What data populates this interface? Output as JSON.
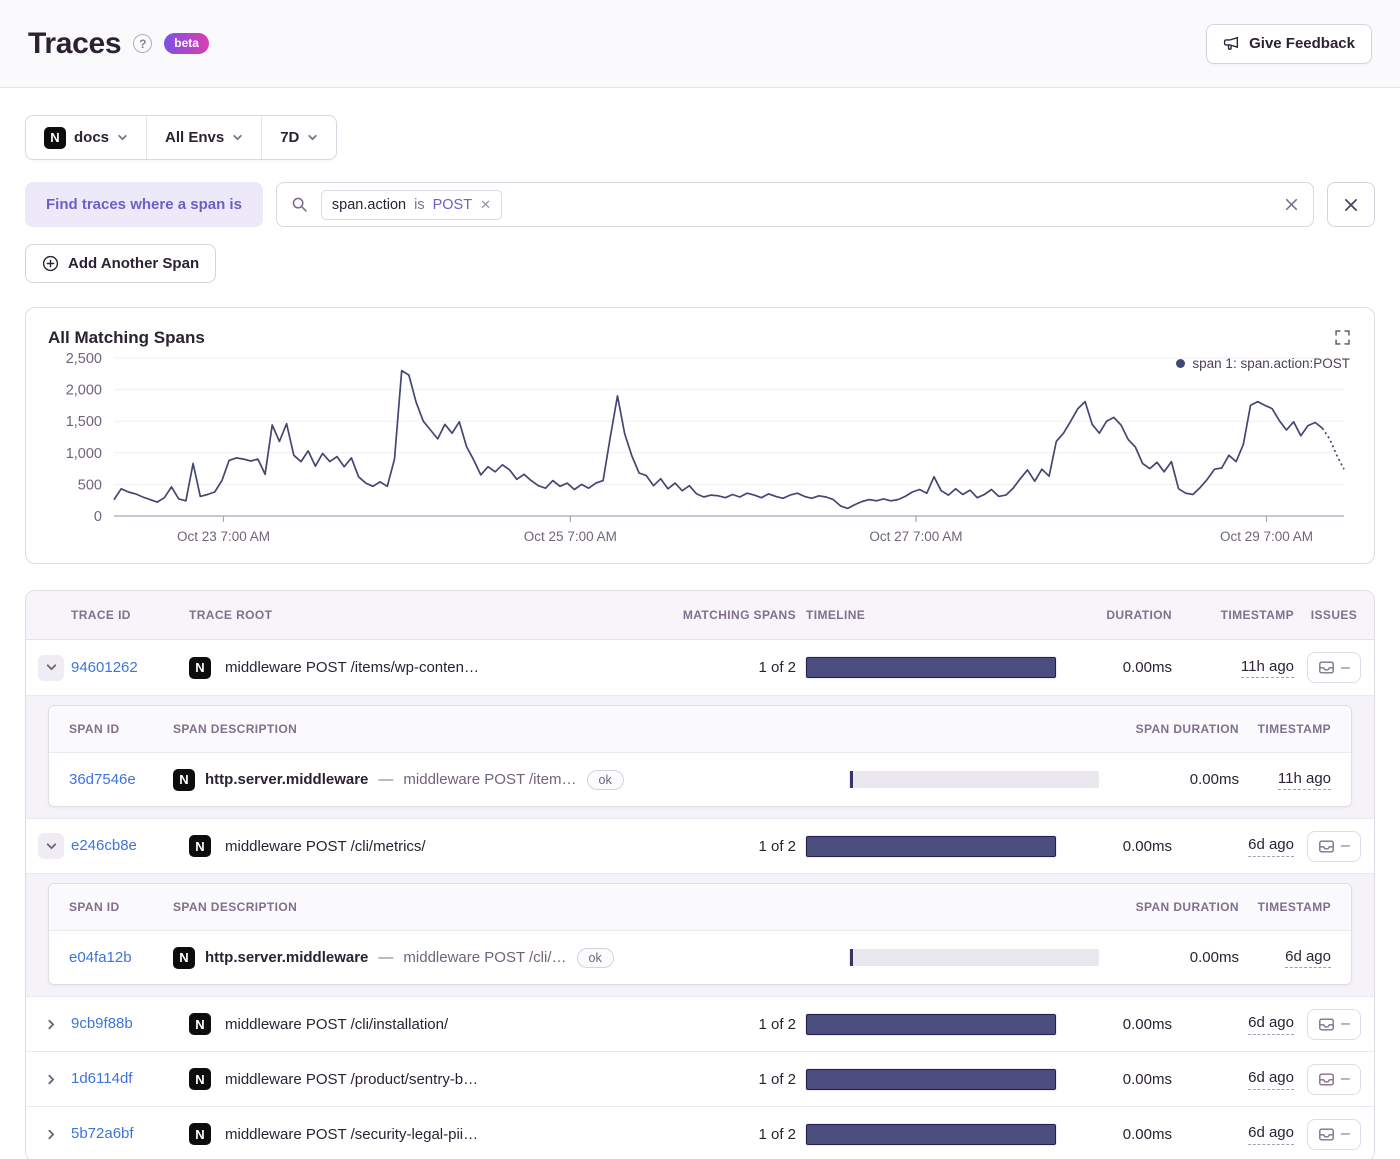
{
  "header": {
    "title": "Traces",
    "beta": "beta",
    "feedback": "Give Feedback"
  },
  "filters": {
    "project": "docs",
    "environment": "All Envs",
    "period": "7D"
  },
  "query": {
    "label": "Find traces where a span is",
    "chip": {
      "key": "span.action",
      "op": "is",
      "value": "POST"
    },
    "add_span": "Add Another Span"
  },
  "chart": {
    "title": "All Matching Spans",
    "legend": "span 1: span.action:POST"
  },
  "chart_data": {
    "type": "line",
    "title": "All Matching Spans",
    "legend_position": "top-right",
    "grid": "horizontal",
    "line_color": "#444674",
    "x_axis": {
      "tick_labels": [
        "Oct 23 7:00 AM",
        "Oct 25 7:00 AM",
        "Oct 27 7:00 AM",
        "Oct 29 7:00 AM"
      ],
      "tick_fractions": [
        0.089,
        0.371,
        0.652,
        0.937
      ],
      "range": "last 7 days, Oct 22 - Oct 29"
    },
    "y_axis": {
      "tick_labels": [
        "0",
        "500",
        "1,000",
        "1,500",
        "2,000",
        "2,500"
      ],
      "tick_values": [
        0,
        500,
        1000,
        1500,
        2000,
        2500
      ],
      "ylim": [
        0,
        2500
      ]
    },
    "dashed_tail_points": 3,
    "series": [
      {
        "name": "span 1: span.action:POST",
        "values": [
          260,
          430,
          380,
          350,
          300,
          260,
          220,
          290,
          460,
          270,
          240,
          830,
          310,
          340,
          380,
          560,
          880,
          920,
          900,
          870,
          900,
          660,
          1440,
          1180,
          1460,
          960,
          860,
          1030,
          790,
          990,
          860,
          940,
          780,
          920,
          620,
          520,
          470,
          540,
          470,
          900,
          2300,
          2230,
          1800,
          1500,
          1360,
          1220,
          1450,
          1310,
          1490,
          1100,
          890,
          650,
          780,
          700,
          810,
          730,
          580,
          660,
          560,
          480,
          440,
          560,
          470,
          520,
          420,
          500,
          440,
          520,
          560,
          1250,
          1900,
          1300,
          950,
          680,
          640,
          480,
          590,
          430,
          520,
          400,
          480,
          350,
          300,
          330,
          320,
          290,
          340,
          300,
          360,
          330,
          290,
          350,
          310,
          280,
          330,
          360,
          310,
          280,
          320,
          300,
          260,
          160,
          120,
          180,
          230,
          260,
          240,
          270,
          240,
          260,
          310,
          380,
          420,
          360,
          620,
          400,
          330,
          430,
          340,
          410,
          290,
          340,
          420,
          310,
          330,
          440,
          590,
          730,
          550,
          740,
          630,
          1180,
          1310,
          1500,
          1700,
          1810,
          1450,
          1310,
          1500,
          1560,
          1440,
          1210,
          1090,
          830,
          750,
          850,
          700,
          860,
          430,
          360,
          340,
          450,
          580,
          740,
          760,
          960,
          860,
          1130,
          1750,
          1810,
          1750,
          1700,
          1510,
          1360,
          1490,
          1270,
          1430,
          1480,
          1390,
          1220,
          960,
          740
        ]
      }
    ]
  },
  "table": {
    "columns": [
      "Trace ID",
      "Trace Root",
      "Matching Spans",
      "Timeline",
      "Duration",
      "Timestamp",
      "Issues"
    ],
    "span_columns": [
      "Span ID",
      "Span Description",
      "Span Duration",
      "Timestamp"
    ],
    "rows": [
      {
        "trace_id": "94601262",
        "root": "middleware POST /items/wp-conten…",
        "matching_spans": "1 of 2",
        "duration": "0.00ms",
        "timestamp": "11h ago",
        "issues": "–",
        "expanded": true,
        "spans": [
          {
            "span_id": "36d7546e",
            "op": "http.server.middleware",
            "description": "middleware POST /item…",
            "status": "ok",
            "duration": "0.00ms",
            "timestamp": "11h ago"
          }
        ]
      },
      {
        "trace_id": "e246cb8e",
        "root": "middleware POST /cli/metrics/",
        "matching_spans": "1 of 2",
        "duration": "0.00ms",
        "timestamp": "6d ago",
        "issues": "–",
        "expanded": true,
        "spans": [
          {
            "span_id": "e04fa12b",
            "op": "http.server.middleware",
            "description": "middleware POST /cli/…",
            "status": "ok",
            "duration": "0.00ms",
            "timestamp": "6d ago"
          }
        ]
      },
      {
        "trace_id": "9cb9f88b",
        "root": "middleware POST /cli/installation/",
        "matching_spans": "1 of 2",
        "duration": "0.00ms",
        "timestamp": "6d ago",
        "issues": "–",
        "expanded": false,
        "spans": []
      },
      {
        "trace_id": "1d6114df",
        "root": "middleware POST /product/sentry-b…",
        "matching_spans": "1 of 2",
        "duration": "0.00ms",
        "timestamp": "6d ago",
        "issues": "–",
        "expanded": false,
        "spans": []
      },
      {
        "trace_id": "5b72a6bf",
        "root": "middleware POST /security-legal-pii…",
        "matching_spans": "1 of 2",
        "duration": "0.00ms",
        "timestamp": "6d ago",
        "issues": "–",
        "expanded": false,
        "spans": []
      }
    ]
  },
  "colors": {
    "accent": "#6D5FC7",
    "link": "#3D74DB",
    "chart_line": "#444674",
    "timeline_bar": "#4A4D7E",
    "beta_gradient_start": "#7B51E6",
    "beta_gradient_end": "#D93FAE"
  }
}
